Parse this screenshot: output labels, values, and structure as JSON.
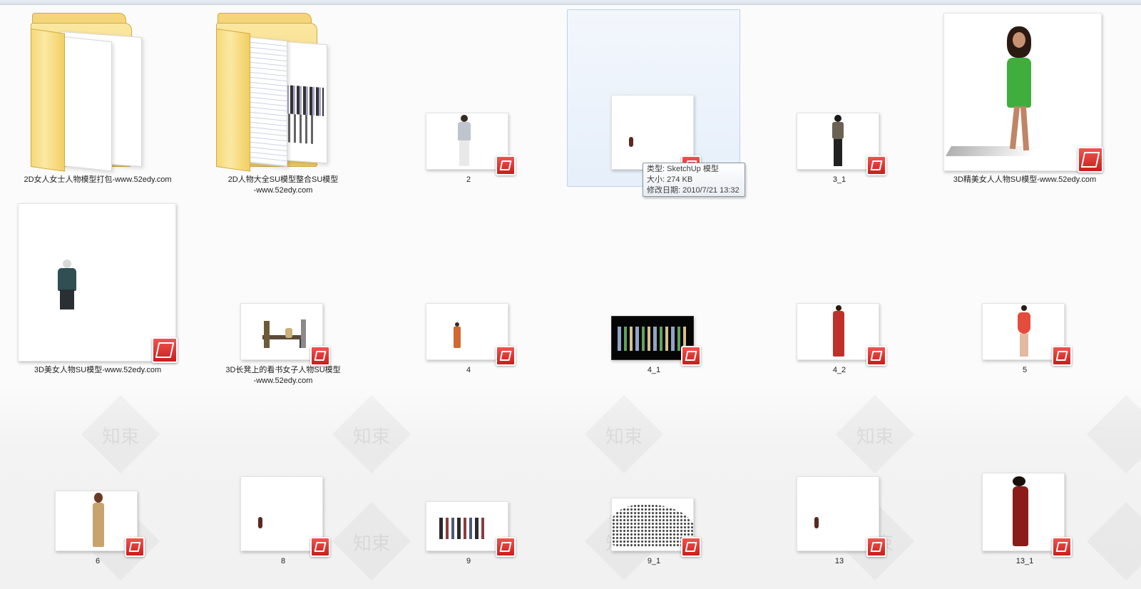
{
  "items": [
    {
      "label": "2D女人女士人物模型打包-www.52edy.com",
      "kind": "folder"
    },
    {
      "label": "2D人物大全SU模型整合SU模型-www.52edy.com",
      "kind": "folder"
    },
    {
      "label": "2",
      "kind": "sketchup"
    },
    {
      "label": "",
      "kind": "sketchup"
    },
    {
      "label": "3_1",
      "kind": "sketchup"
    },
    {
      "label": "3D精美女人人物SU模型-www.52edy.com",
      "kind": "sketchup"
    },
    {
      "label": "3D美女人物SU模型-www.52edy.com",
      "kind": "sketchup"
    },
    {
      "label": "3D长凳上的看书女子人物SU模型-www.52edy.com",
      "kind": "sketchup"
    },
    {
      "label": "4",
      "kind": "sketchup"
    },
    {
      "label": "4_1",
      "kind": "sketchup"
    },
    {
      "label": "4_2",
      "kind": "sketchup"
    },
    {
      "label": "5",
      "kind": "sketchup"
    },
    {
      "label": "6",
      "kind": "sketchup"
    },
    {
      "label": "8",
      "kind": "sketchup"
    },
    {
      "label": "9",
      "kind": "sketchup"
    },
    {
      "label": "9_1",
      "kind": "sketchup"
    },
    {
      "label": "13",
      "kind": "sketchup"
    },
    {
      "label": "13_1",
      "kind": "sketchup"
    }
  ],
  "labels_split": {
    "item1_line1": "2D人物大全SU模型整合SU模型",
    "item1_line2": "-www.52edy.com",
    "item7_line1": "3D长凳上的看书女子人物SU模型",
    "item7_line2": "-www.52edy.com"
  },
  "tooltip": {
    "type": "类型: SketchUp 模型",
    "size": "大小: 274 KB",
    "modified": "修改日期: 2010/7/21 13:32"
  },
  "watermark": "知束",
  "colors": {
    "selection": "#e6effa",
    "sketchup_red": "#d8302c",
    "folder_yellow": "#f5d57a",
    "dress_green": "#3fae3c"
  }
}
